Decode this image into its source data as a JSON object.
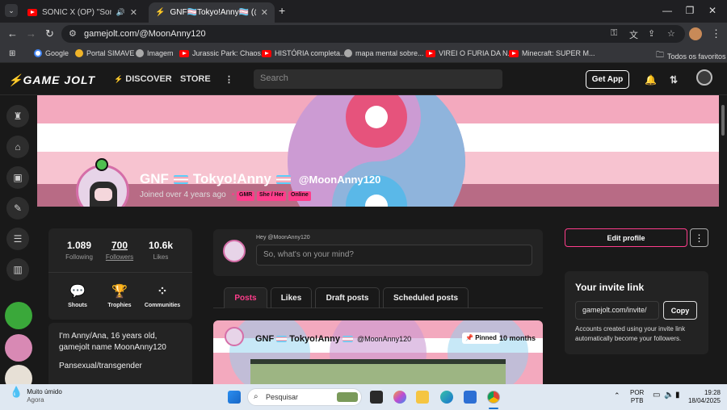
{
  "browser": {
    "tabs": [
      {
        "title": "SONIC X (OP) \"Sonic Drive\"",
        "active": false
      },
      {
        "title": "GNF🏳️‍⚧️Tokyo!Anny🏳️‍⚧️ (@Moon",
        "active": true
      }
    ],
    "new_tab": "+",
    "url": "gamejolt.com/@MoonAnny120",
    "bookmarks": [
      "Google",
      "Portal SIMAVE",
      "Imagem",
      "Jurassic Park: Chaos...",
      "HISTÓRIA completa...",
      "mapa mental sobre...",
      "VIREI O FURIA DA N...",
      "Minecraft: SUPER M...",
      "Todos os favoritos"
    ]
  },
  "gj": {
    "logo": "GAME JOLT",
    "discover": "DISCOVER",
    "store": "STORE",
    "search_placeholder": "Search",
    "get_app": "Get App"
  },
  "profile": {
    "display_name": "GNF",
    "display_name_2": "Tokyo!Anny",
    "username": "@MoonAnny120",
    "joined": "Joined over 4 years ago",
    "tags": [
      "GMR",
      "She / Her",
      "Online"
    ],
    "stats": [
      {
        "value": "1.089",
        "label": "Following"
      },
      {
        "value": "700",
        "label": "Followers"
      },
      {
        "value": "10.6k",
        "label": "Likes"
      }
    ],
    "shortcuts": [
      "Shouts",
      "Trophies",
      "Communities"
    ],
    "bio": [
      "I'm Anny/Ana, 16 years old, gamejolt name MoonAnny120",
      "Pansexual/transgender"
    ],
    "edit_profile": "Edit profile",
    "more": "⋮"
  },
  "post_box": {
    "label": "Hey @MoonAnny120",
    "placeholder": "So, what's on your mind?"
  },
  "post_tabs": [
    "Posts",
    "Likes",
    "Draft posts",
    "Scheduled posts"
  ],
  "post": {
    "author": "GNF",
    "author_2": "Tokyo!Anny",
    "username": "@MoonAnny120",
    "pinned": "Pinned",
    "time": "10 months"
  },
  "invite": {
    "title": "Your invite link",
    "link": "gamejolt.com/invite/",
    "copy": "Copy",
    "description": "Accounts created using your invite link automatically become your followers."
  },
  "taskbar": {
    "weather_title": "Muito úmido",
    "weather_sub": "Agora",
    "search": "Pesquisar",
    "lang_1": "POR",
    "lang_2": "PTB",
    "time": "19:28",
    "date": "18/04/2025"
  }
}
